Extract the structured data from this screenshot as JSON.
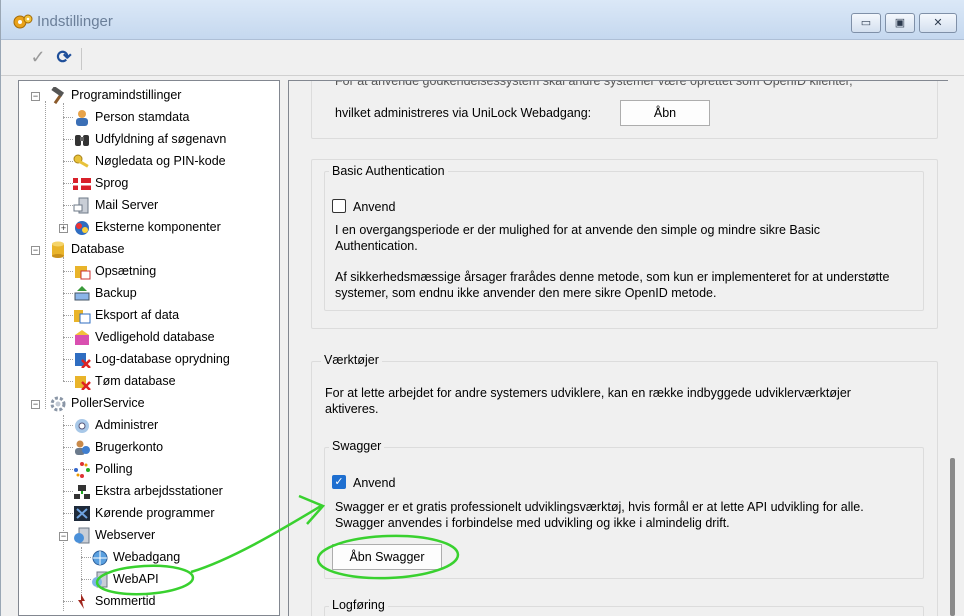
{
  "window": {
    "title": "Indstillinger",
    "controls": {
      "minimize": "▭",
      "maximize": "▣",
      "close": "✕"
    }
  },
  "toolbar": {
    "apply_icon": "✓",
    "refresh_icon": "⟳"
  },
  "tree": {
    "root_program": "Programindstillinger",
    "items_program": [
      "Person stamdata",
      "Udfyldning af søgenavn",
      "Nøgledata og PIN-kode",
      "Sprog",
      "Mail Server",
      "Eksterne komponenter"
    ],
    "root_database": "Database",
    "items_database": [
      "Opsætning",
      "Backup",
      "Eksport af data",
      "Vedligehold database",
      "Log-database oprydning",
      "Tøm database"
    ],
    "root_poller": "PollerService",
    "items_poller": [
      "Administrer",
      "Brugerkonto",
      "Polling",
      "Ekstra arbejdsstationer",
      "Kørende programmer",
      "Webserver"
    ],
    "items_webserver": [
      "Webadgang",
      "WebAPI"
    ],
    "last_item": "Sommertid"
  },
  "main": {
    "truncated_top": "For at anvende godkendelsessystem skal andre systemer være oprettet som OpenID klienter,",
    "webadgang_text": "hvilket administreres via UniLock Webadgang:",
    "open_button": "Åbn",
    "basic_auth": {
      "title": "Basic Authentication",
      "checkbox_label": "Anvend",
      "text1": "I en overgangsperiode er der mulighed for at anvende den simple og mindre sikre Basic Authentication.",
      "text2": "Af sikkerhedsmæssige årsager frarådes denne metode, som kun er implementeret for at understøtte systemer, som endnu ikke anvender den mere sikre OpenID metode."
    },
    "tools": {
      "title": "Værktøjer",
      "text": "For at lette arbejdet for andre systemers udviklere, kan en række indbyggede udviklerværktøjer aktiveres."
    },
    "swagger": {
      "title": "Swagger",
      "checkbox_label": "Anvend",
      "text": "Swagger er et gratis professionelt udviklingsværktøj, hvis formål er at lette API udvikling for alle. Swagger anvendes i forbindelse med udvikling og ikke i almindelig drift.",
      "button": "Åbn Swagger"
    },
    "logging": {
      "title": "Logføring"
    }
  },
  "colors": {
    "annotation": "#39d12f",
    "checkbox_accent": "#1e6fd0"
  }
}
